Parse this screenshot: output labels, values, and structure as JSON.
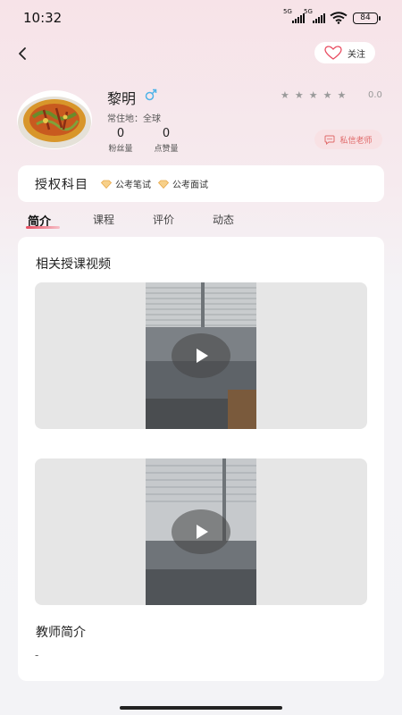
{
  "status_bar": {
    "time": "10:32",
    "network_1": "5G",
    "network_2": "5G",
    "battery": "84"
  },
  "header": {
    "follow_label": "关注"
  },
  "teacher": {
    "name": "黎明",
    "location": "常住地：全球",
    "fans_count": "0",
    "fans_label": "粉丝量",
    "likes_count": "0",
    "likes_label": "点赞量",
    "rating": "0.0",
    "rating_stars": 0,
    "message_label": "私信老师"
  },
  "subjects": {
    "title": "授权科目",
    "items": [
      {
        "label": "公考笔试"
      },
      {
        "label": "公考面试"
      }
    ]
  },
  "tabs": [
    {
      "label": "简介",
      "active": true
    },
    {
      "label": "课程",
      "active": false
    },
    {
      "label": "评价",
      "active": false
    },
    {
      "label": "动态",
      "active": false
    }
  ],
  "content": {
    "videos_title": "相关授课视频",
    "intro_title": "教师简介",
    "intro_text": "-"
  },
  "colors": {
    "accent": "#e84a5f",
    "message_text": "#e06a6a",
    "message_bg": "#f8e1e4",
    "gender": "#4fb3e8"
  }
}
